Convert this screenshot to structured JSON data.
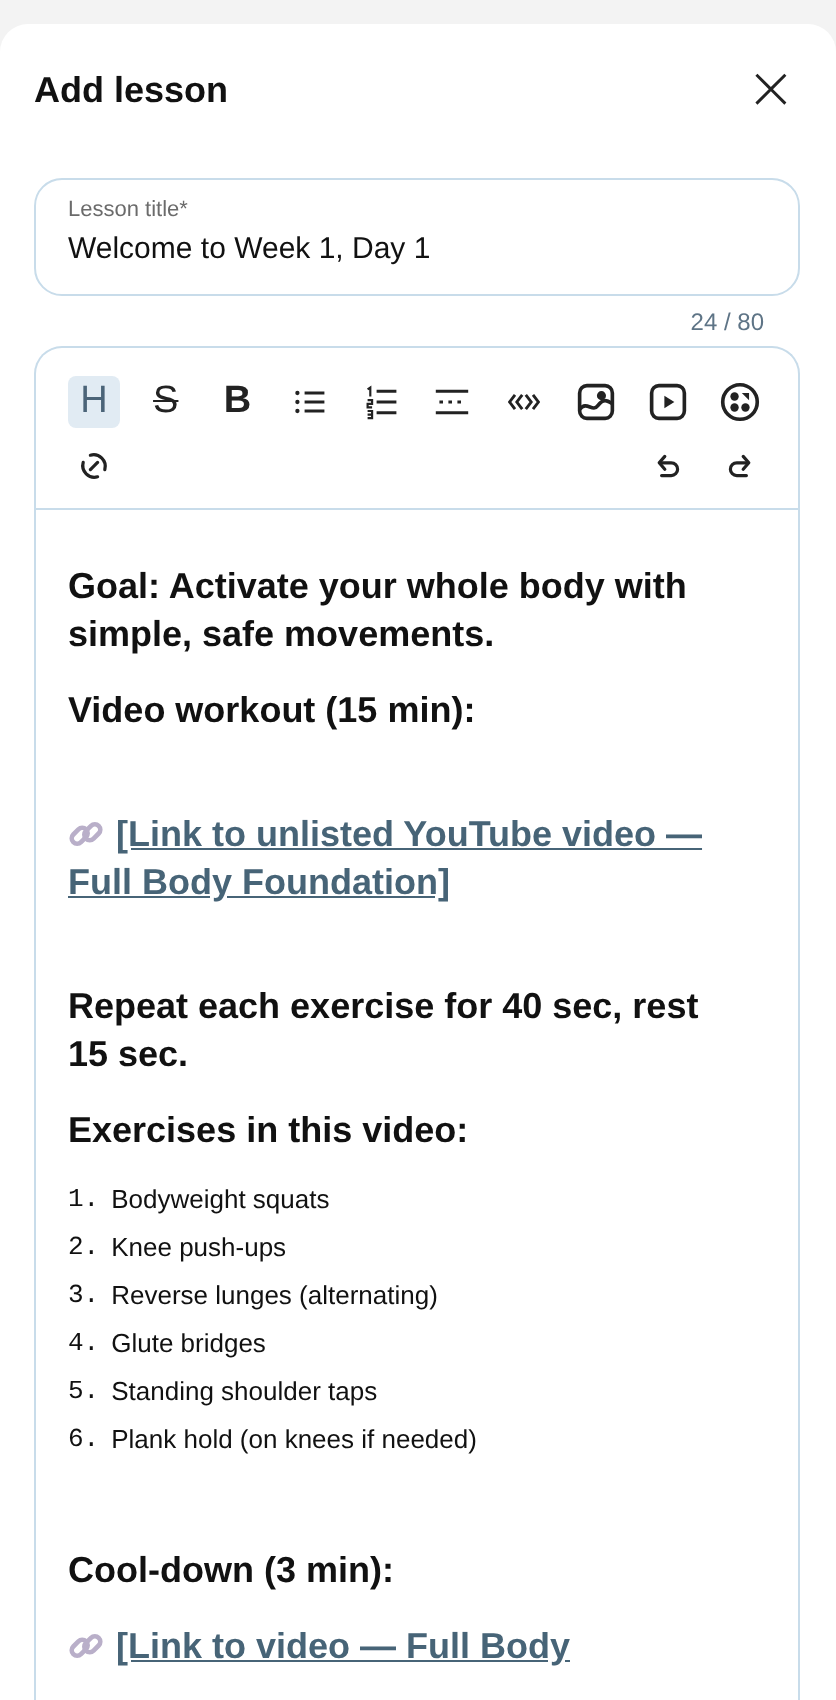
{
  "header": {
    "title": "Add lesson",
    "close": "×"
  },
  "title_field": {
    "label": "Lesson title",
    "required_mark": "*",
    "value": "Welcome to Week 1, Day 1",
    "counter": "24 / 80"
  },
  "toolbar": [
    {
      "kind": "heading",
      "label": "H",
      "active": true
    },
    {
      "kind": "strike",
      "label": "S",
      "active": false
    },
    {
      "kind": "bold",
      "label": "B",
      "active": false
    },
    {
      "kind": "bullets",
      "active": false
    },
    {
      "kind": "numbers",
      "active": false
    },
    {
      "kind": "rule",
      "active": false
    },
    {
      "kind": "code",
      "active": false
    },
    {
      "kind": "image",
      "active": false
    },
    {
      "kind": "video",
      "active": false
    },
    {
      "kind": "embed",
      "active": false
    },
    {
      "kind": "link",
      "active": false
    },
    {
      "kind": "undo",
      "active": false
    },
    {
      "kind": "redo",
      "active": false
    }
  ],
  "content": [
    {
      "kind": "heading",
      "text": "Goal: Activate your whole body with simple, safe movements."
    },
    {
      "kind": "heading",
      "text": "Video workout (15 min):"
    },
    {
      "kind": "link",
      "text": "[Link to unlisted YouTube video — Full Body Foundation]"
    },
    {
      "kind": "heading",
      "text": "Repeat each exercise for 40 sec, rest 15 sec."
    },
    {
      "kind": "heading",
      "text": "Exercises in this video:"
    },
    {
      "kind": "list",
      "items": [
        {
          "number": "1.",
          "text": "Bodyweight squats"
        },
        {
          "number": "2.",
          "text": "Knee push-ups"
        },
        {
          "number": "3.",
          "text": "Reverse lunges (alternating)"
        },
        {
          "number": "4.",
          "text": "Glute bridges"
        },
        {
          "number": "5.",
          "text": "Standing shoulder taps"
        },
        {
          "number": "6.",
          "text": "Plank hold (on knees if needed)"
        }
      ]
    },
    {
      "kind": "heading",
      "text": "Cool-down (3 min):"
    },
    {
      "kind": "link",
      "text": "[Link to video — Full Body"
    }
  ]
}
